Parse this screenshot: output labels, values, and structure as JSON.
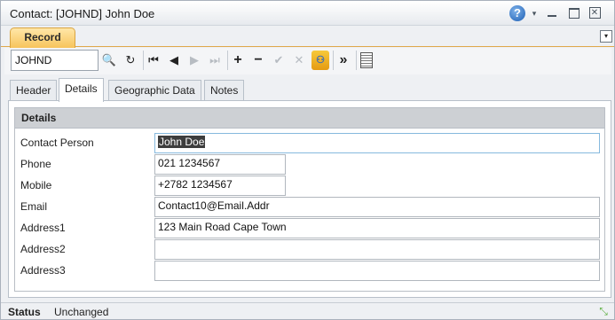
{
  "window": {
    "title": "Contact: [JOHND] John Doe",
    "help_glyph": "?",
    "dropdown_glyph": "▾",
    "close_glyph": "✕"
  },
  "ribbon": {
    "tabs": [
      {
        "label": "Record",
        "active": true
      }
    ],
    "collapse_glyph": "▾"
  },
  "toolbar": {
    "record_code": "JOHND",
    "buttons": [
      {
        "name": "search-icon",
        "glyph": "🔍",
        "enabled": true
      },
      {
        "name": "refresh-icon",
        "glyph": "↻",
        "enabled": true
      },
      {
        "name": "first-record-icon",
        "glyph": "⏮",
        "enabled": true
      },
      {
        "name": "previous-record-icon",
        "glyph": "◀",
        "enabled": true
      },
      {
        "name": "next-record-icon",
        "glyph": "▶",
        "enabled": false
      },
      {
        "name": "last-record-icon",
        "glyph": "⏭",
        "enabled": false
      },
      {
        "name": "add-icon",
        "glyph": "+",
        "enabled": true
      },
      {
        "name": "remove-icon",
        "glyph": "−",
        "enabled": true
      },
      {
        "name": "save-check-icon",
        "glyph": "✔",
        "enabled": false
      },
      {
        "name": "cancel-x-icon",
        "glyph": "✕",
        "enabled": false
      },
      {
        "name": "linked-records-icon",
        "glyph": "⚇",
        "enabled": true
      },
      {
        "name": "more-icon",
        "glyph": "»",
        "enabled": true
      },
      {
        "name": "list-view-icon",
        "glyph": "",
        "enabled": true
      }
    ]
  },
  "tabs": [
    {
      "label": "Header",
      "active": false
    },
    {
      "label": "Details",
      "active": true
    },
    {
      "label": "Geographic Data",
      "active": false
    },
    {
      "label": "Notes",
      "active": false
    }
  ],
  "details": {
    "heading": "Details",
    "fields": [
      {
        "label": "Contact Person",
        "value": "John Doe"
      },
      {
        "label": "Phone",
        "value": "021 1234567"
      },
      {
        "label": "Mobile",
        "value": "+2782 1234567"
      },
      {
        "label": "Email",
        "value": "Contact10@Email.Addr"
      },
      {
        "label": "Address1",
        "value": "123 Main Road Cape Town"
      },
      {
        "label": "Address2",
        "value": ""
      },
      {
        "label": "Address3",
        "value": ""
      }
    ]
  },
  "status": {
    "label": "Status",
    "value": "Unchanged"
  },
  "colors": {
    "record_tab": "#f7c45c",
    "group_header": "#cdd0d4",
    "selection": "#3d3d3d",
    "focus_border": "#86b9de"
  }
}
